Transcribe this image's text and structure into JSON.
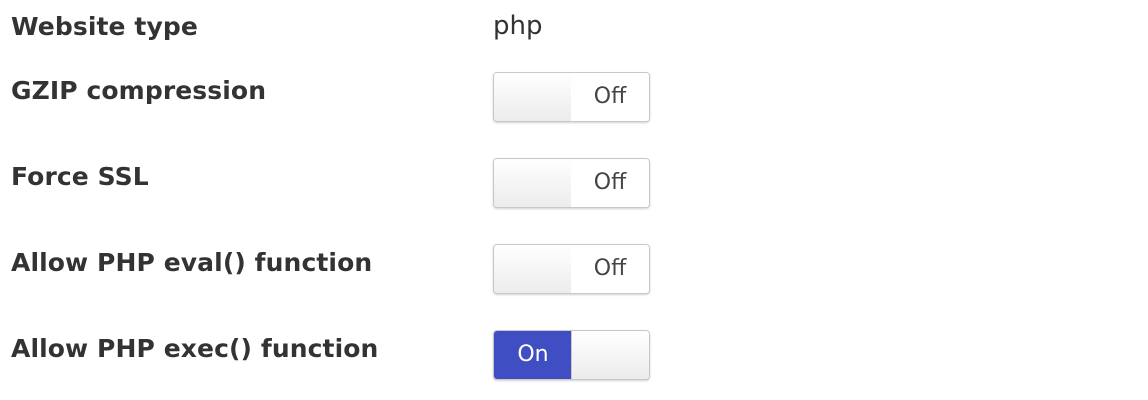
{
  "settings": {
    "website_type": {
      "label": "Website type",
      "value": "php"
    },
    "gzip": {
      "label": "GZIP compression",
      "state": "Off"
    },
    "force_ssl": {
      "label": "Force SSL",
      "state": "Off"
    },
    "php_eval": {
      "label": "Allow PHP eval() function",
      "state": "Off"
    },
    "php_exec": {
      "label": "Allow PHP exec() function",
      "state": "On"
    }
  },
  "colors": {
    "toggle_on": "#3f4ec2",
    "toggle_border": "#c8c8c8",
    "text": "#333333"
  }
}
